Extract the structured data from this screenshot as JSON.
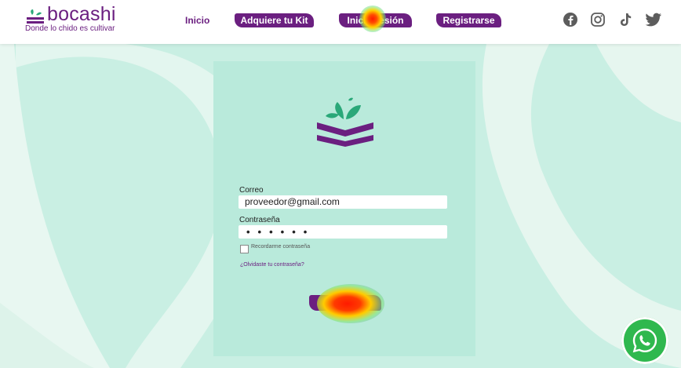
{
  "header": {
    "brand": "bocashi",
    "tagline": "Donde lo chido es cultivar",
    "nav": [
      {
        "label": "Inicio",
        "style": "plain"
      },
      {
        "label": "Adquiere tu Kit",
        "style": "pill"
      },
      {
        "label": "Inicia sesión",
        "style": "pill"
      },
      {
        "label": "Registrarse",
        "style": "pill"
      }
    ],
    "social": [
      "facebook-icon",
      "instagram-icon",
      "tiktok-icon",
      "twitter-icon"
    ]
  },
  "login": {
    "email_label": "Correo",
    "email_value": "proveedor@gmail.com",
    "password_label": "Contraseña",
    "password_mask": "••••••",
    "remember_label": "Recordarme contraseña",
    "forgot_link": "¿Olvidaste tu contraseña?",
    "submit_label": ""
  },
  "colors": {
    "brand_purple": "#6b1f80",
    "brand_green": "#2aa879",
    "card_bg": "#b9eadb",
    "page_bg": "#c9efe3",
    "whatsapp": "#2fb84e"
  },
  "floating": {
    "whatsapp_icon": "whatsapp-icon"
  }
}
